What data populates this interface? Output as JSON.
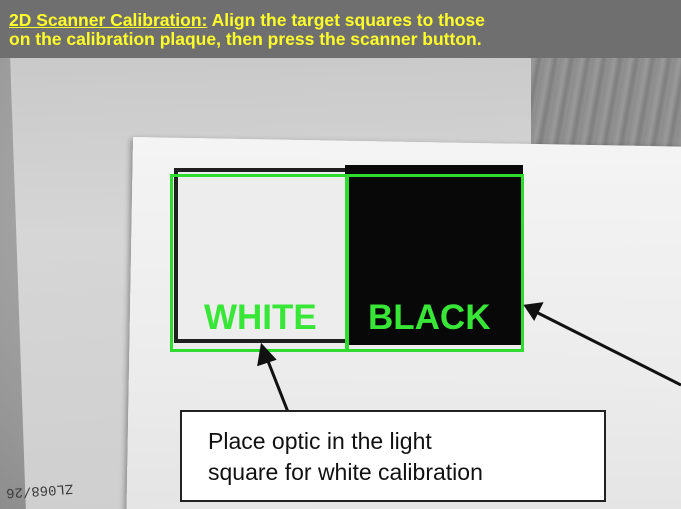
{
  "header": {
    "title": "2D Scanner Calibration:",
    "instruction_line1": "Align the target squares to those",
    "instruction_line2": "on the calibration plaque, then press the scanner button."
  },
  "targets": {
    "white_label": "WHITE",
    "black_label": "BLACK"
  },
  "callout": {
    "line1": "Place optic in the light",
    "line2": "square for white calibration"
  },
  "plaque_serial": "ZL068/26",
  "colors": {
    "header_text": "#ffff2a",
    "target_outline": "#2edb2e",
    "target_label": "#37e637"
  }
}
